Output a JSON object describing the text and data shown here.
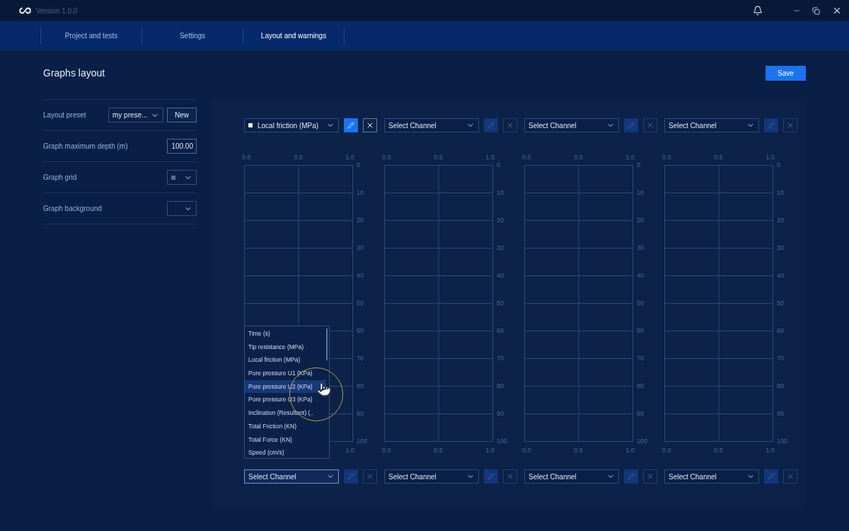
{
  "window": {
    "version": "Version 1.0.0"
  },
  "nav": [
    {
      "label": "Project and tests",
      "selected": false
    },
    {
      "label": "Settings",
      "selected": false
    },
    {
      "label": "Layout and warnings",
      "selected": true
    }
  ],
  "page": {
    "title": "Graphs layout",
    "save_button": "Save"
  },
  "settings": [
    {
      "kind": "preset",
      "label": "Layout preset",
      "value": "my prese...",
      "button": "New"
    },
    {
      "kind": "number",
      "label": "Graph maximum depth (m)",
      "value": "100.00"
    },
    {
      "kind": "color",
      "label": "Graph grid",
      "color": "#5a6f8f"
    },
    {
      "kind": "color",
      "label": "Graph background"
    }
  ],
  "graphs": [
    {
      "top_channel": {
        "label": "Local friction (MPa)",
        "color": "#ffffff",
        "assigned": true,
        "open": false
      },
      "top_ticks": [
        "0.0",
        "0.5",
        "1.0"
      ],
      "y_ticks": [
        "0",
        "10",
        "20",
        "30",
        "40",
        "50",
        "60",
        "70",
        "80",
        "90",
        "100"
      ],
      "bottom_ticks": [
        "1.0"
      ],
      "bottom_channel": {
        "label": "Select Channel",
        "assigned": false,
        "open": true
      }
    },
    {
      "top_channel": {
        "label": "Select Channel",
        "assigned": false,
        "open": false
      },
      "top_ticks": [
        "0.0",
        "0.5",
        "1.0"
      ],
      "y_ticks": [
        "0",
        "10",
        "20",
        "30",
        "40",
        "50",
        "60",
        "70",
        "80",
        "90",
        "100"
      ],
      "bottom_ticks": [
        "0.0",
        "0.5",
        "1.0"
      ],
      "bottom_channel": {
        "label": "Select Channel",
        "assigned": false,
        "open": false
      }
    },
    {
      "top_channel": {
        "label": "Select Channel",
        "assigned": false,
        "open": false
      },
      "top_ticks": [
        "0.0",
        "0.5",
        "1.0"
      ],
      "y_ticks": [
        "0",
        "10",
        "20",
        "30",
        "40",
        "50",
        "60",
        "70",
        "80",
        "90",
        "100"
      ],
      "bottom_ticks": [
        "0.0",
        "0.5",
        "1.0"
      ],
      "bottom_channel": {
        "label": "Select Channel",
        "assigned": false,
        "open": false
      }
    },
    {
      "top_channel": {
        "label": "Select Channel",
        "assigned": false,
        "open": false
      },
      "top_ticks": [
        "0.0",
        "0.5",
        "1.0"
      ],
      "y_ticks": [
        "0",
        "10",
        "20",
        "30",
        "40",
        "50",
        "60",
        "70",
        "80",
        "90",
        "100"
      ],
      "bottom_ticks": [
        "0.0",
        "0.5",
        "1.0"
      ],
      "bottom_channel": {
        "label": "Select Channel",
        "assigned": false,
        "open": false
      }
    }
  ],
  "channel_menu": [
    {
      "label": "Time (s)",
      "selected": false
    },
    {
      "label": "Tip resistance (MPa)",
      "selected": false
    },
    {
      "label": "Local friction (MPa)",
      "selected": false
    },
    {
      "label": "Pore pressure U1 (KPa)",
      "selected": false
    },
    {
      "label": "Pore pressure U2 (KPa)",
      "selected": true
    },
    {
      "label": "Pore pressure U3 (KPa)",
      "selected": false
    },
    {
      "label": "Inclination (Resultant) (..",
      "selected": false
    },
    {
      "label": "Total Friction (KN)",
      "selected": false
    },
    {
      "label": "Total Force (KN)",
      "selected": false
    },
    {
      "label": "Speed (cm/s)",
      "selected": false
    }
  ]
}
